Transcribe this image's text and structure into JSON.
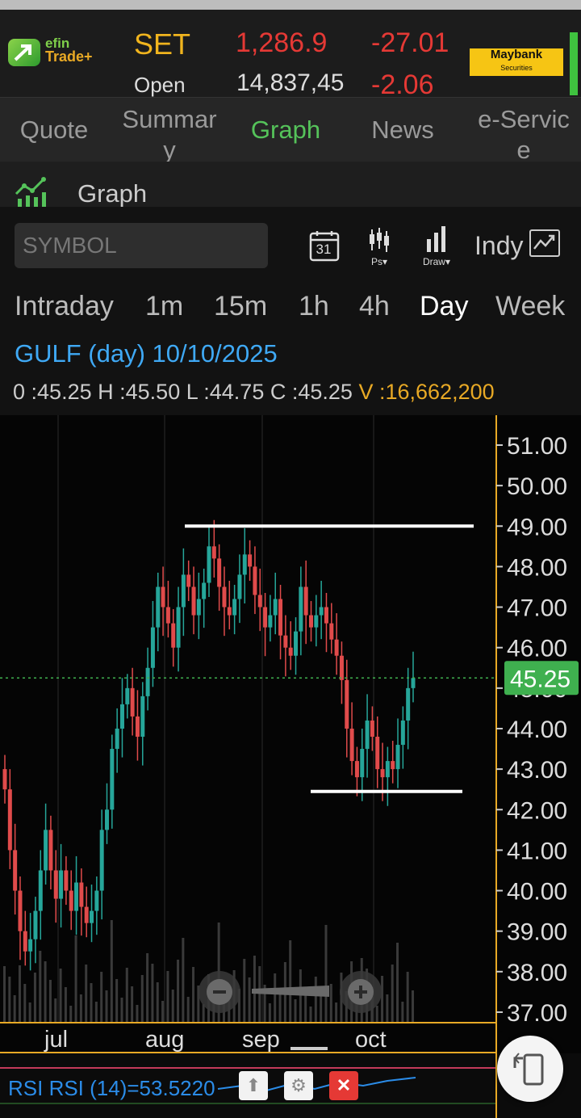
{
  "header": {
    "logo_line1": "efin",
    "logo_line2": "Trade+",
    "index_name": "SET",
    "index_value": "1,286.9",
    "index_change": "-27.01",
    "sub_label": "Open",
    "sub_value": "14,837,45",
    "sub_change": "-2.06",
    "broker_name": "Maybank",
    "broker_sub": "Securities"
  },
  "tabs": [
    {
      "label": "Quote"
    },
    {
      "label": "Summar\ny"
    },
    {
      "label": "Graph",
      "active": true
    },
    {
      "label": "News"
    },
    {
      "label": "e-Servic\ne"
    }
  ],
  "section": {
    "title": "Graph"
  },
  "toolbar": {
    "symbol_placeholder": "SYMBOL",
    "calendar_day": "31",
    "ps_label": "Ps",
    "draw_label": "Draw",
    "indy_label": "Indy"
  },
  "periods": [
    "Intraday",
    "1m",
    "15m",
    "1h",
    "4h",
    "Day",
    "Week"
  ],
  "active_period": "Day",
  "quote": {
    "title": "GULF (day) 10/10/2025",
    "o_label": "0 :",
    "o": "45.25",
    "h_label": "H :",
    "h": "45.50",
    "l_label": "L :",
    "l": "44.75",
    "c_label": "C :",
    "c": "45.25",
    "v_label": "V :",
    "v": "16,662,200"
  },
  "chart_data": {
    "type": "candlestick",
    "title": "",
    "y_ticks": [
      "51.00",
      "50.00",
      "49.00",
      "48.00",
      "47.00",
      "46.00",
      "45.00",
      "44.00",
      "43.00",
      "42.00",
      "41.00",
      "40.00",
      "39.00",
      "38.00",
      "37.00"
    ],
    "ylim": [
      36.8,
      51.4
    ],
    "x_ticks": [
      "jul",
      "aug",
      "sep",
      "oct"
    ],
    "last_price": "45.25",
    "last_price_value": 45.25,
    "drawn_lines": [
      {
        "name": "resistance",
        "value": 49.0
      },
      {
        "name": "support",
        "value": 42.45
      }
    ],
    "close_series": [
      42.5,
      41.0,
      40.0,
      39.0,
      38.5,
      38.8,
      39.5,
      40.5,
      41.5,
      40.5,
      39.8,
      40.5,
      40.0,
      39.5,
      40.2,
      39.6,
      39.2,
      39.5,
      40.0,
      41.5,
      42.0,
      43.5,
      44.0,
      44.6,
      45.0,
      44.3,
      43.8,
      44.8,
      45.5,
      46.5,
      47.5,
      47.0,
      46.6,
      46.0,
      47.0,
      47.8,
      47.5,
      46.8,
      47.2,
      47.6,
      48.5,
      48.2,
      47.5,
      47.0,
      46.8,
      47.2,
      47.8,
      48.3,
      48.0,
      47.3,
      47.0,
      46.5,
      46.8,
      47.2,
      46.3,
      46.0,
      45.8,
      46.4,
      47.5,
      46.8,
      46.5,
      46.8,
      47.0,
      46.6,
      46.2,
      45.8,
      45.2,
      44.0,
      43.2,
      42.8,
      43.5,
      44.2,
      43.8,
      43.0,
      42.8,
      43.2,
      43.0,
      43.6,
      44.2,
      45.0,
      45.25
    ],
    "volume_scale_note": "",
    "rsi": {
      "label": "RSI RSI (14)=53.5220",
      "value": 53.522
    }
  },
  "zoom": {
    "minus": "−",
    "plus": "+"
  },
  "colors": {
    "up": "#26a69a",
    "down": "#e04b4b",
    "doji": "#e8a925",
    "accent": "#55c35a",
    "price_tag": "#3fb04f"
  }
}
